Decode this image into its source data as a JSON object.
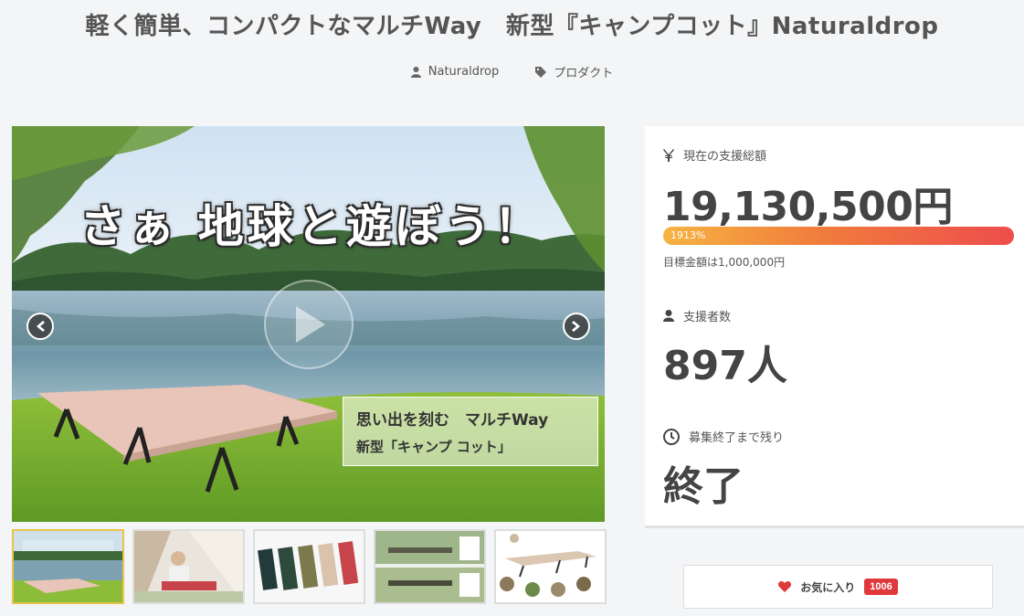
{
  "header": {
    "title": "軽く簡単、コンパクトなマルチWay　新型『キャンプコット』Naturaldrop",
    "author": "Naturaldrop",
    "category": "プロダクト"
  },
  "hero": {
    "overlay_text": "さぁ 地球と遊ぼう！",
    "caption_line1": "思い出を刻む　マルチWay",
    "caption_line2": "新型「キャンプ コット」"
  },
  "stats": {
    "total_label": "現在の支援総額",
    "total_value": "19,130,500円",
    "progress_text": "1913%",
    "progress_percent": 1913,
    "goal_text": "目標金額は1,000,000円",
    "backers_label": "支援者数",
    "backers_value": "897人",
    "remaining_label": "募集終了まで残り",
    "remaining_value": "終了"
  },
  "favorite": {
    "label": "お気に入り",
    "count": "1006"
  },
  "icons": {
    "author": "user-icon",
    "category": "tag-icon",
    "currency": "yen-icon",
    "backers": "user-icon",
    "clock": "clock-icon",
    "favorite": "heart-icon"
  },
  "colors": {
    "accent_red": "#e0393c",
    "progress_start": "#f6b342",
    "progress_end": "#ee4d4d",
    "active_thumb_border": "#e8c44a"
  }
}
